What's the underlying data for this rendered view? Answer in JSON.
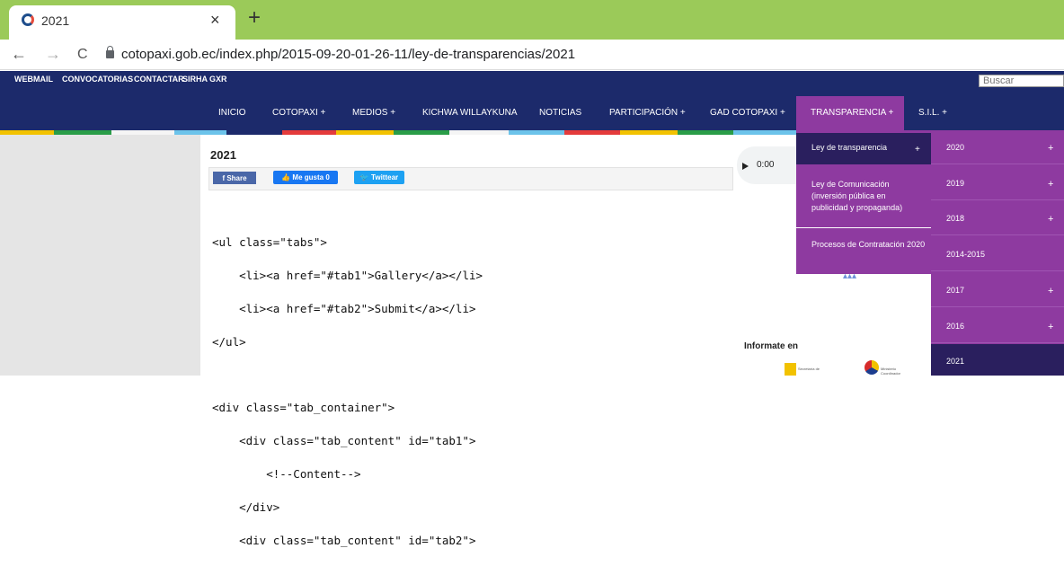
{
  "browser": {
    "tab_title": "2021",
    "close_glyph": "×",
    "new_tab_glyph": "+",
    "back_glyph": "←",
    "forward_glyph": "→",
    "reload_glyph": "C",
    "url": "cotopaxi.gob.ec/index.php/2015-09-20-01-26-11/ley-de-transparencias/2021"
  },
  "topbar": {
    "items": [
      "WEBMAIL",
      "CONVOCATORIAS",
      "CONTACTAR",
      "SIRHA",
      "GXR"
    ],
    "search_placeholder": "Buscar"
  },
  "nav": {
    "items": [
      "INICIO",
      "COTOPAXI +",
      "MEDIOS +",
      "KICHWA WILLAYKUNA",
      "NOTICIAS",
      "PARTICIPACIÓN +",
      "GAD COTOPAXI +",
      "TRANSPARENCIA +",
      "S.I.L. +"
    ],
    "active": "TRANSPARENCIA +"
  },
  "content": {
    "title": "2021",
    "share_label": "Share",
    "like_label": "Me gusta 0",
    "tweet_label": "Twittear",
    "code_lines": [
      "<ul class=\"tabs\">",
      "    <li><a href=\"#tab1\">Gallery</a></li>",
      "    <li><a href=\"#tab2\">Submit</a></li>",
      "</ul>",
      "",
      "<div class=\"tab_container\">",
      "    <div class=\"tab_content\" id=\"tab1\">",
      "        <!--Content-->",
      "    </div>",
      "    <div class=\"tab_content\" id=\"tab2\">"
    ]
  },
  "sidebar": {
    "audio_time": "0:00",
    "informate_label": "Informate en",
    "logo_a_text": "Secretaría de",
    "logo_b_text": "Ministerio Coordinador"
  },
  "dropdown": {
    "items": [
      {
        "label": "Ley de transparencia",
        "plus": "+"
      },
      {
        "label": "Ley de Comunicación (inversión pública en publicidad y propaganda)"
      },
      {
        "label": "Procesos de Contratación 2020"
      }
    ]
  },
  "subpanel": {
    "items": [
      {
        "label": "2020",
        "plus": "+"
      },
      {
        "label": "2019",
        "plus": "+"
      },
      {
        "label": "2018",
        "plus": "+"
      },
      {
        "label": "2014-2015",
        "plus": ""
      },
      {
        "label": "2017",
        "plus": "+"
      },
      {
        "label": "2016",
        "plus": "+"
      },
      {
        "label": "2021",
        "plus": ""
      }
    ]
  },
  "colors": {
    "tabbar": "#9bca59",
    "nav_bg": "#1c2a6b",
    "menu_purple": "#8e3aa0",
    "menu_dark": "#2a1f5e"
  }
}
